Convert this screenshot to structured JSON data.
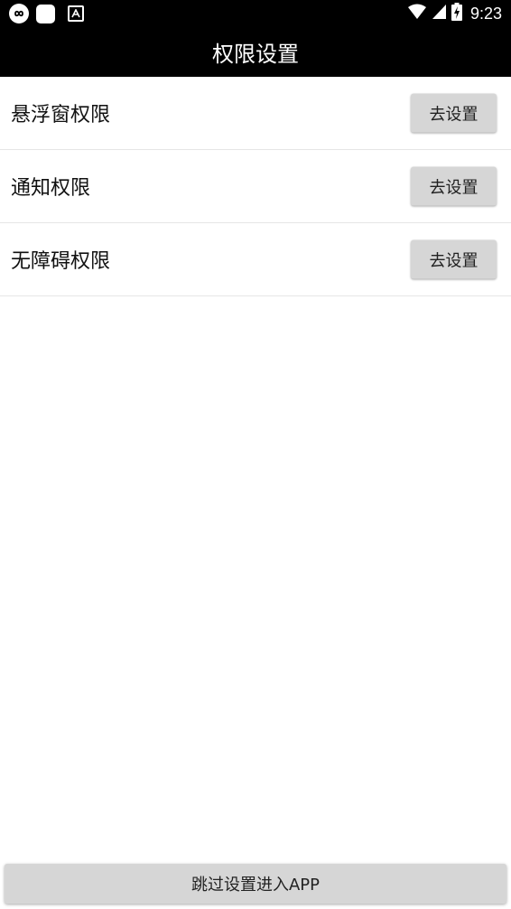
{
  "status_bar": {
    "time": "9:23",
    "left_icons": [
      "infinity-app-icon",
      "white-square-app-icon",
      "a-letter-app-icon"
    ],
    "right_icons": [
      "wifi-icon",
      "cell-signal-icon",
      "battery-charging-icon"
    ]
  },
  "toolbar": {
    "title": "权限设置"
  },
  "permissions": [
    {
      "label": "悬浮窗权限",
      "button_label": "去设置"
    },
    {
      "label": "通知权限",
      "button_label": "去设置"
    },
    {
      "label": "无障碍权限",
      "button_label": "去设置"
    }
  ],
  "footer": {
    "skip_label": "跳过设置进入APP"
  },
  "colors": {
    "toolbar_bg": "#000000",
    "button_bg": "#d6d6d6",
    "divider": "#e6e6e6",
    "text": "#111111"
  }
}
